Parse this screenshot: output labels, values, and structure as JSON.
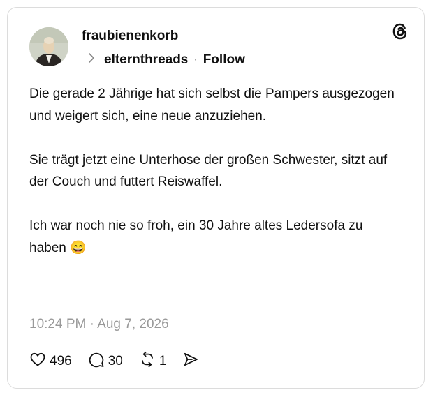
{
  "post": {
    "username": "fraubienenkorb",
    "community": "elternthreads",
    "separator": "·",
    "follow_label": "Follow",
    "paragraphs": [
      "Die gerade 2 Jährige hat sich selbst die Pampers ausgezogen und weigert sich, eine neue anzuziehen.",
      "Sie trägt jetzt eine Unterhose der großen Schwester, sitzt auf der Couch und futtert Reiswaffel.",
      "Ich war noch nie so froh, ein 30 Jahre altes Ledersofa zu haben 😄"
    ],
    "timestamp": "10:24 PM · Aug 7, 2026",
    "likes": "496",
    "replies": "30",
    "reposts": "1"
  },
  "icons": {
    "logo": "threads-logo-icon",
    "chevron": "chevron-right-icon",
    "like": "heart-icon",
    "reply": "comment-icon",
    "repost": "repost-icon",
    "share": "send-icon"
  }
}
